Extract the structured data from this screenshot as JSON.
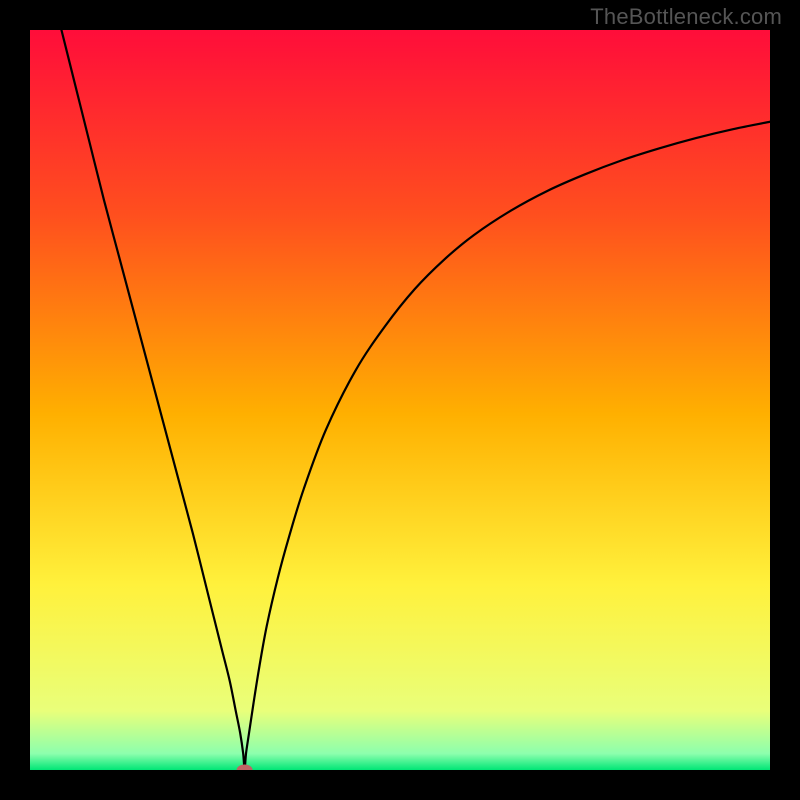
{
  "watermark": "TheBottleneck.com",
  "chart_data": {
    "type": "line",
    "title": "",
    "xlabel": "",
    "ylabel": "",
    "xlim": [
      0,
      100
    ],
    "ylim": [
      0,
      100
    ],
    "background_gradient": {
      "stops": [
        {
          "pos": 0.0,
          "color": "#ff0d3a"
        },
        {
          "pos": 0.25,
          "color": "#ff4f1e"
        },
        {
          "pos": 0.52,
          "color": "#ffb000"
        },
        {
          "pos": 0.75,
          "color": "#fff13c"
        },
        {
          "pos": 0.92,
          "color": "#e9ff7a"
        },
        {
          "pos": 0.978,
          "color": "#8cffad"
        },
        {
          "pos": 1.0,
          "color": "#00e676"
        }
      ]
    },
    "min_marker": {
      "x": 29,
      "y": 0,
      "color": "#be6464"
    },
    "series": [
      {
        "name": "bottleneck-curve",
        "x": [
          0,
          2,
          4,
          6,
          8,
          10,
          12,
          14,
          16,
          18,
          20,
          22,
          24,
          25,
          26,
          27,
          27.8,
          28.4,
          28.8,
          29,
          29.2,
          29.6,
          30.2,
          31,
          32,
          33.5,
          35,
          37,
          40,
          44,
          48,
          52,
          56,
          60,
          65,
          70,
          75,
          80,
          85,
          90,
          95,
          100
        ],
        "y": [
          117,
          109,
          101,
          93,
          85,
          77,
          69.5,
          62,
          54.5,
          47,
          39.5,
          32,
          24,
          20,
          16,
          12,
          8,
          5,
          2.3,
          0.2,
          2.3,
          5,
          9,
          14,
          19.5,
          26,
          31.5,
          38,
          46,
          54,
          60,
          65,
          69,
          72.3,
          75.6,
          78.3,
          80.5,
          82.4,
          84,
          85.4,
          86.6,
          87.6
        ]
      }
    ]
  }
}
